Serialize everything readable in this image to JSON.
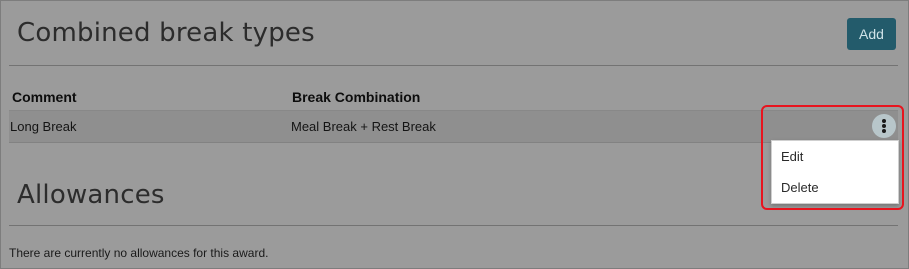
{
  "combined": {
    "title": "Combined break types",
    "add_label": "Add",
    "columns": [
      "Comment",
      "Break Combination"
    ],
    "rows": [
      {
        "comment": "Long Break",
        "combination": "Meal Break + Rest Break"
      }
    ],
    "row_menu": {
      "icon": "kebab-menu-icon",
      "items": [
        "Edit",
        "Delete"
      ]
    }
  },
  "allowances": {
    "title": "Allowances",
    "empty_message": "There are currently no allowances for this award."
  },
  "colors": {
    "accent": "#235b6b",
    "highlight": "#e8141e",
    "overlay": "#9b9b9b"
  }
}
